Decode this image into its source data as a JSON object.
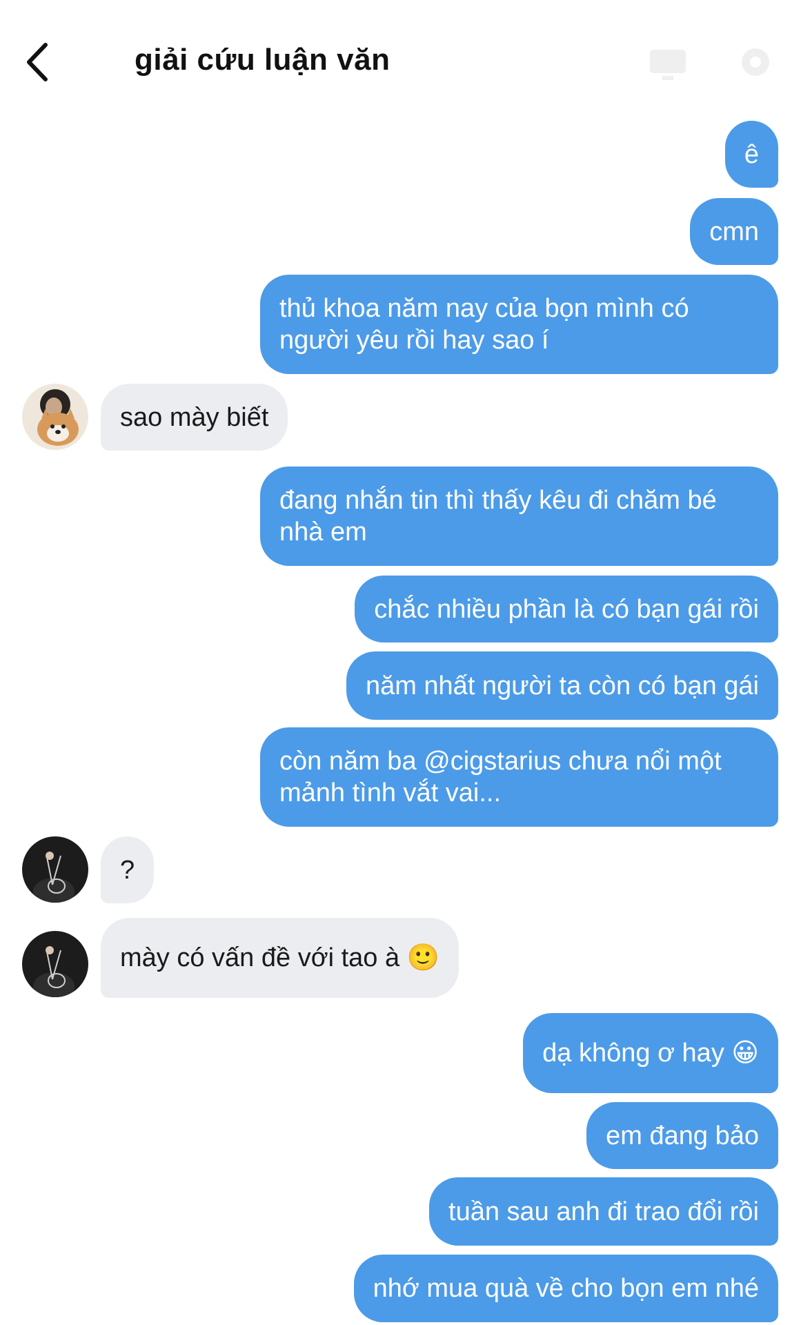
{
  "header": {
    "title": "giải cứu luận văn",
    "back_icon": "chevron-left-icon",
    "keyboard_icon": "keyboard-icon",
    "settings_icon": "gear-icon"
  },
  "colors": {
    "outgoing_bubble": "#4c9be8",
    "incoming_bubble": "#ebedf0",
    "text_dark": "#1a1a1a"
  },
  "messages": [
    {
      "side": "out",
      "text": "ê"
    },
    {
      "side": "out",
      "text": "cmn"
    },
    {
      "side": "out",
      "text": "thủ khoa năm nay của bọn mình có người yêu rồi hay sao í"
    },
    {
      "side": "in",
      "text": "sao mày biết",
      "avatar": "avatar-dog"
    },
    {
      "side": "out",
      "text": "đang nhắn tin thì thấy kêu đi chăm bé nhà em"
    },
    {
      "side": "out",
      "text": "chắc nhiều phần là có bạn gái rồi"
    },
    {
      "side": "out",
      "text": "năm nhất người ta còn có bạn gái"
    },
    {
      "side": "out",
      "text": "còn năm ba @cigstarius chưa nổi một mảnh tình vắt vai..."
    },
    {
      "side": "in",
      "text": "?",
      "avatar": "avatar-dark"
    },
    {
      "side": "in",
      "text": "mày có vấn đề với tao à 🙂",
      "avatar": "avatar-dark"
    },
    {
      "side": "out",
      "text": "dạ không ơ hay 😀"
    },
    {
      "side": "out",
      "text": "em đang bảo"
    },
    {
      "side": "out",
      "text": "tuần sau anh đi trao đổi rồi"
    },
    {
      "side": "out",
      "text": "nhớ mua quà về cho bọn em nhé"
    }
  ]
}
